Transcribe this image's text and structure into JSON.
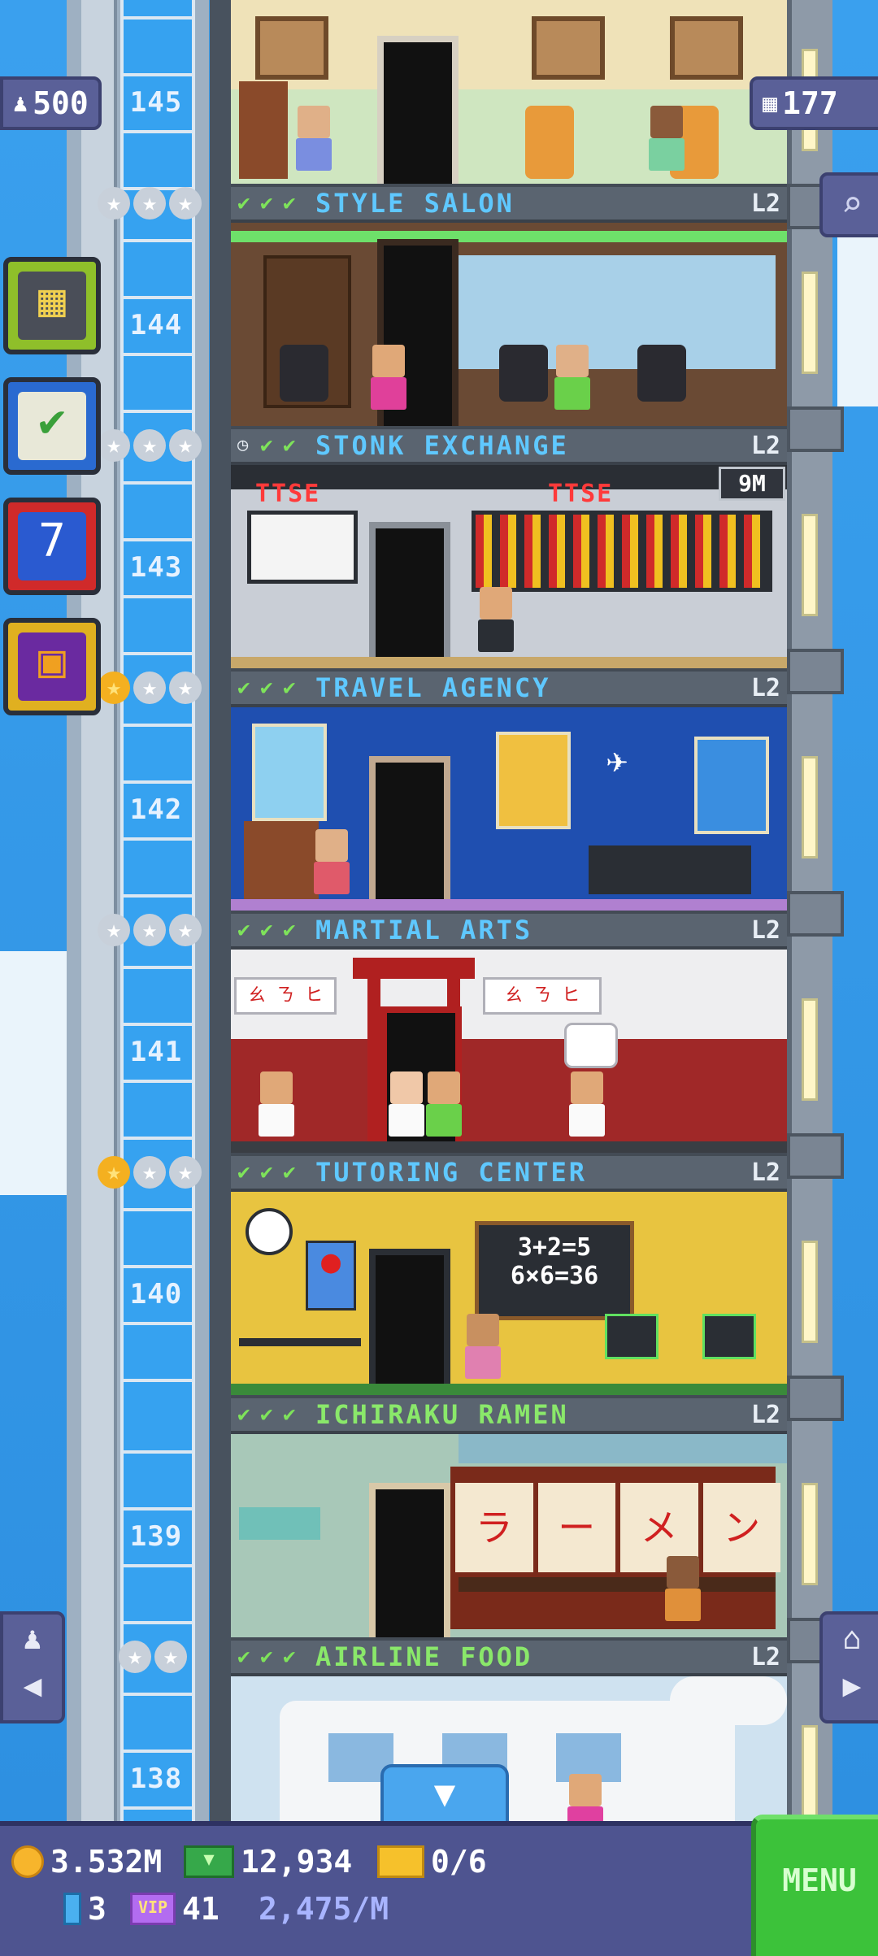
{
  "top_bar": {
    "population": "500",
    "floors": "177"
  },
  "floors": [
    {
      "number": "145",
      "name": "STYLE SALON",
      "level": "L2",
      "status": [
        "check",
        "check",
        "check"
      ],
      "stars": 3,
      "gold_stars": 0,
      "name_color": "#5fc8ff"
    },
    {
      "number": "144",
      "name": "STONK EXCHANGE",
      "level": "L2",
      "status": [
        "clock",
        "check",
        "check"
      ],
      "stars": 3,
      "gold_stars": 0,
      "name_color": "#5fc8ff",
      "badge": "9M",
      "signs": [
        "TTSE",
        "TTSE"
      ]
    },
    {
      "number": "143",
      "name": "TRAVEL AGENCY",
      "level": "L2",
      "status": [
        "check",
        "check",
        "check"
      ],
      "stars": 3,
      "gold_stars": 1,
      "name_color": "#5fc8ff"
    },
    {
      "number": "142",
      "name": "MARTIAL ARTS",
      "level": "L2",
      "status": [
        "check",
        "check",
        "check"
      ],
      "stars": 3,
      "gold_stars": 0,
      "name_color": "#5fc8ff"
    },
    {
      "number": "141",
      "name": "TUTORING CENTER",
      "level": "L2",
      "status": [
        "check",
        "check",
        "check"
      ],
      "stars": 3,
      "gold_stars": 1,
      "name_color": "#5fc8ff",
      "board": [
        "3+2=5",
        "6×6=36"
      ]
    },
    {
      "number": "140",
      "name": "ICHIRAKU RAMEN",
      "level": "L2",
      "status": [
        "check",
        "check",
        "check"
      ],
      "stars": 0,
      "gold_stars": 0,
      "name_color": "#8ae86a",
      "banner": [
        "ラ",
        "ー",
        "メ",
        "ン"
      ]
    },
    {
      "number": "139",
      "name": "AIRLINE FOOD",
      "level": "L2",
      "status": [
        "check",
        "check",
        "check"
      ],
      "stars": 2,
      "gold_stars": 0,
      "name_color": "#8ae86a"
    },
    {
      "number": "138"
    }
  ],
  "side_buttons": [
    {
      "name": "building-button",
      "icon": "building-icon",
      "color": "#8fbf2a"
    },
    {
      "name": "missions-button",
      "icon": "checklist-icon",
      "color": "#2a6ad0"
    },
    {
      "name": "calendar-button",
      "icon": "calendar-icon",
      "color": "#d02a2a"
    },
    {
      "name": "gift-button",
      "icon": "gift-icon",
      "color": "#e0b020"
    }
  ],
  "bottom_bar": {
    "coins": "3.532M",
    "tower_bux": "12,934",
    "tickets": "0/6",
    "gems": "3",
    "vip": "41",
    "rate": "2,475/M",
    "menu_label": "MENU"
  }
}
